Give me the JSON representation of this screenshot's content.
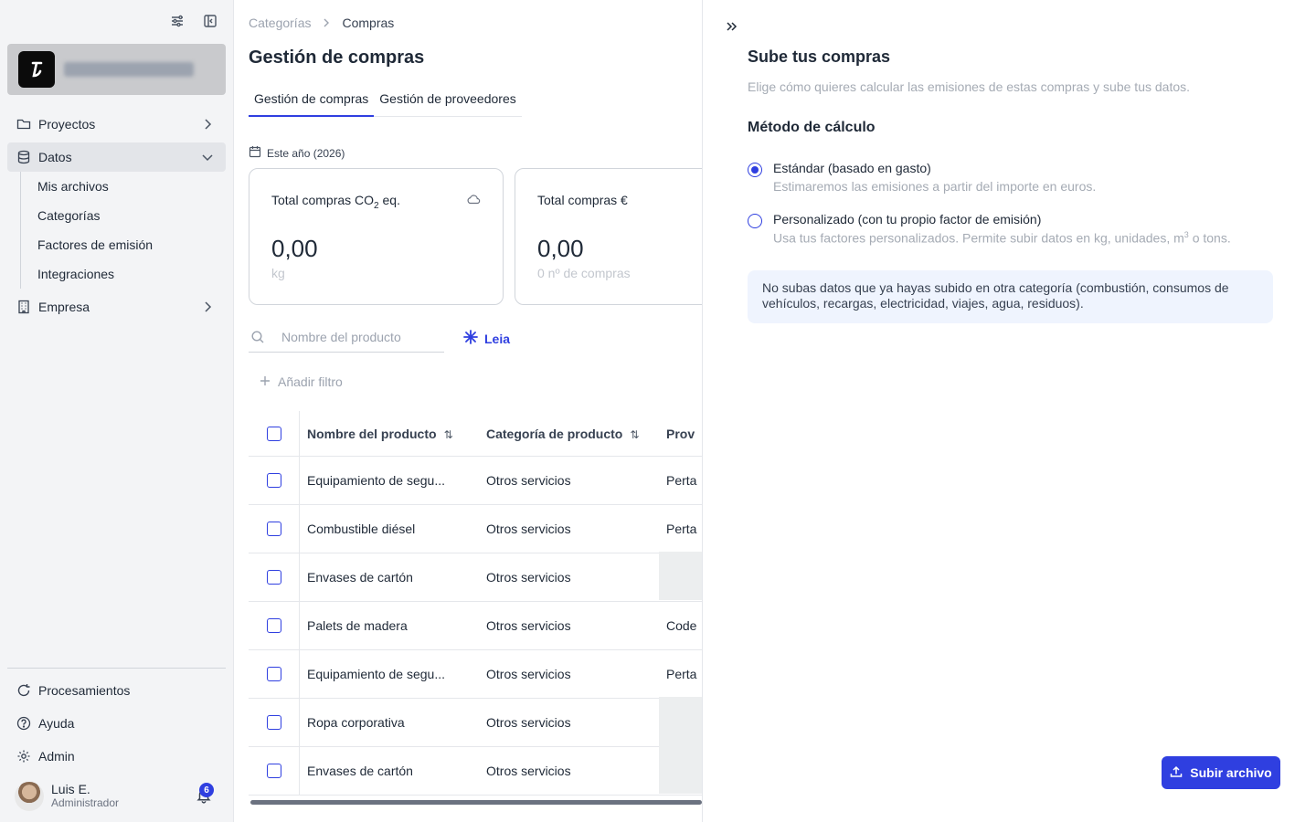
{
  "sidebar": {
    "nav": [
      {
        "label": "Proyectos"
      },
      {
        "label": "Datos"
      },
      {
        "label": "Empresa"
      }
    ],
    "datos_sub": [
      "Mis archivos",
      "Categorías",
      "Factores de emisión",
      "Integraciones"
    ],
    "bottom": [
      {
        "label": "Procesamientos"
      },
      {
        "label": "Ayuda"
      },
      {
        "label": "Admin"
      }
    ],
    "user": {
      "name": "Luis E.",
      "role": "Administrador",
      "notifications": "6"
    }
  },
  "breadcrumb": {
    "parent": "Categorías",
    "current": "Compras"
  },
  "page": {
    "title": "Gestión de compras"
  },
  "tabs": [
    "Gestión de compras",
    "Gestión de proveedores"
  ],
  "period": "Este año (2026)",
  "cards": [
    {
      "title_main": "Total compras CO",
      "title_sub": "2",
      "title_tail": " eq.",
      "value": "0,00",
      "sub": "kg"
    },
    {
      "title": "Total compras €",
      "value": "0,00",
      "sub": "0 nº de compras"
    }
  ],
  "search": {
    "placeholder": "Nombre del producto"
  },
  "leia_label": "Leia",
  "add_filter": "Añadir filtro",
  "table": {
    "headers": [
      "Nombre del producto",
      "Categoría de producto",
      "Prov"
    ],
    "rows": [
      {
        "name": "Equipamiento de segu...",
        "category": "Otros servicios",
        "provider": "Perta"
      },
      {
        "name": "Combustible diésel",
        "category": "Otros servicios",
        "provider": "Perta"
      },
      {
        "name": "Envases de cartón",
        "category": "Otros servicios",
        "provider": ""
      },
      {
        "name": "Palets de madera",
        "category": "Otros servicios",
        "provider": "Code"
      },
      {
        "name": "Equipamiento de segu...",
        "category": "Otros servicios",
        "provider": "Perta"
      },
      {
        "name": "Ropa corporativa",
        "category": "Otros servicios",
        "provider": ""
      },
      {
        "name": "Envases de cartón",
        "category": "Otros servicios",
        "provider": ""
      }
    ]
  },
  "panel": {
    "title": "Sube tus compras",
    "description": "Elige cómo quieres calcular las emisiones de estas compras y sube tus datos.",
    "method_title": "Método de cálculo",
    "options": [
      {
        "label": "Estándar (basado en gasto)",
        "help": "Estimaremos las emisiones a partir del importe en euros.",
        "selected": true
      },
      {
        "label": "Personalizado (con tu propio factor de emisión)",
        "help_a": "Usa tus factores personalizados. Permite subir datos en kg, unidades, m",
        "help_sup": "3",
        "help_b": " o tons.",
        "selected": false
      }
    ],
    "notice": "No subas datos que ya hayas subido en otra categoría (combustión, consumos de vehículos, recargas, electricidad, viajes, agua, residuos).",
    "upload_button": "Subir archivo"
  },
  "colors": {
    "accent": "#2f3fe0",
    "sidebar_bg": "#f3f4f6",
    "notice_bg": "#eff4fe"
  }
}
